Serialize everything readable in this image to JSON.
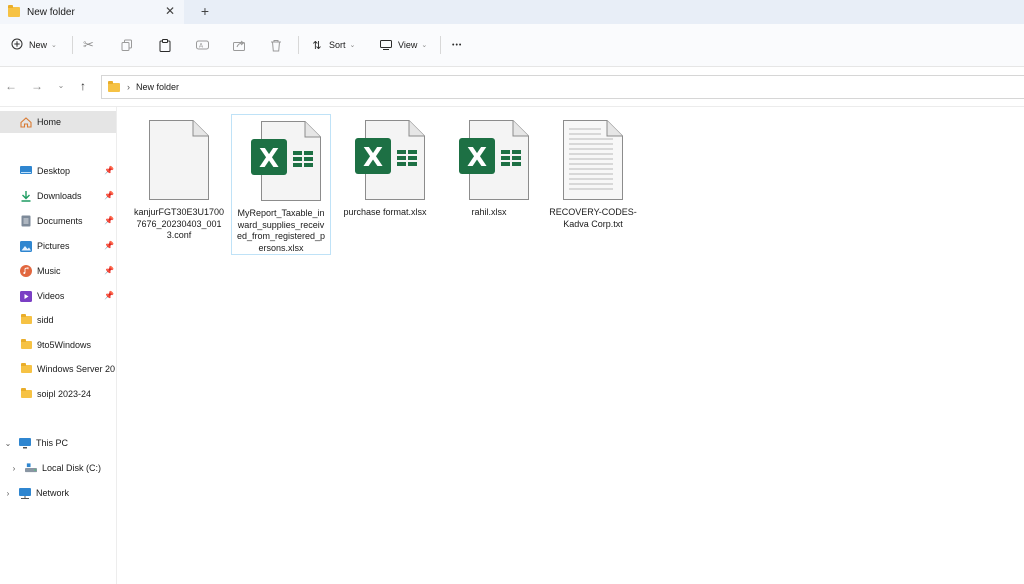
{
  "window": {
    "tab_title": "New folder",
    "close_glyph": "✕",
    "new_tab_glyph": "+"
  },
  "toolbar": {
    "new_label": "New",
    "sort_label": "Sort",
    "view_label": "View",
    "more_glyph": "•••"
  },
  "address": {
    "breadcrumb": "New folder"
  },
  "sidebar": {
    "home": "Home",
    "quick_access": [
      {
        "label": "Desktop",
        "icon": "desktop-icon",
        "pinned": true
      },
      {
        "label": "Downloads",
        "icon": "downloads-icon",
        "pinned": true
      },
      {
        "label": "Documents",
        "icon": "documents-icon",
        "pinned": true
      },
      {
        "label": "Pictures",
        "icon": "pictures-icon",
        "pinned": true
      },
      {
        "label": "Music",
        "icon": "music-icon",
        "pinned": true
      },
      {
        "label": "Videos",
        "icon": "videos-icon",
        "pinned": true
      },
      {
        "label": "sidd",
        "icon": "folder-icon"
      },
      {
        "label": "9to5Windows",
        "icon": "folder-icon"
      },
      {
        "label": "Windows Server 20",
        "icon": "folder-icon"
      },
      {
        "label": "soipl 2023-24",
        "icon": "folder-icon"
      }
    ],
    "this_pc": "This PC",
    "local_disk": "Local Disk (C:)",
    "network": "Network"
  },
  "files": [
    {
      "name": "kanjurFGT30E3U17007676_20230403_0013.conf",
      "type": "conf",
      "selected": false
    },
    {
      "name": "MyReport_Taxable_inward_supplies_received_from_registered_persons.xlsx",
      "type": "xlsx",
      "selected": true
    },
    {
      "name": "purchase format.xlsx",
      "type": "xlsx",
      "selected": false
    },
    {
      "name": "rahil.xlsx",
      "type": "xlsx",
      "selected": false
    },
    {
      "name": "RECOVERY-CODES-Kadva Corp.txt",
      "type": "txt",
      "selected": false
    }
  ],
  "colors": {
    "excel_green": "#1d7044",
    "folder_yellow": "#f6c244",
    "selection_border": "#bfe2f7",
    "home_bg": "#e5e5e5"
  }
}
